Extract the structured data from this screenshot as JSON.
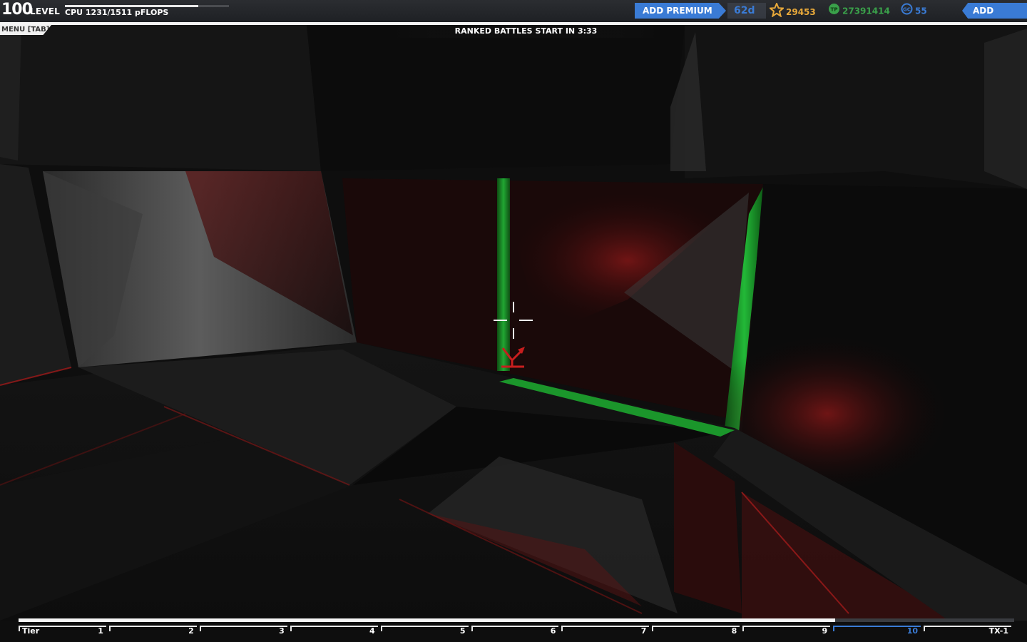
{
  "hud": {
    "level_number": "100",
    "level_label": "LEVEL",
    "cpu_text": "CPU 1231/1511 pFLOPS",
    "cpu_fill": 0.815,
    "menu_label": "MENU [TAB]",
    "ranked_banner": "RANKED BATTLES START IN 3:33"
  },
  "topbar": {
    "add_premium": "ADD PREMIUM",
    "premium_days": "62d",
    "robits": "29453",
    "robits_icon": "robits-icon",
    "tech_points": "27391414",
    "tech_points_icon": "tech-points-icon",
    "galaxy_coins": "55",
    "galaxy_coins_icon": "galaxy-coins-icon",
    "add_funds": "ADD FUNDS"
  },
  "tier_bar": {
    "label": "Tier",
    "progress": 0.82,
    "tiers": [
      "1",
      "2",
      "3",
      "4",
      "5",
      "6",
      "7",
      "8",
      "9",
      "10",
      "TX-1"
    ],
    "active_tier": "10"
  },
  "colors": {
    "accent_blue": "#3a7bd5",
    "robits_gold": "#e8a93a",
    "tech_green": "#3aa04a",
    "neon_red": "#c81e1e",
    "neon_green": "#18c030"
  }
}
